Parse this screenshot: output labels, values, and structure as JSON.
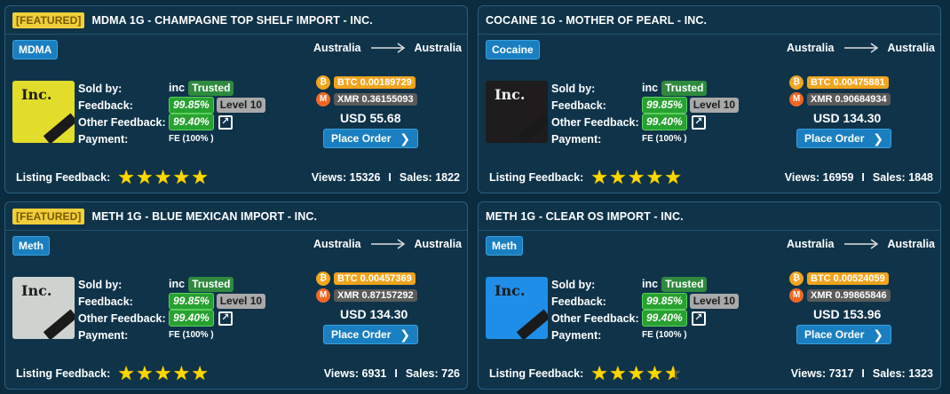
{
  "listings": [
    {
      "featured_label": "[FEATURED]",
      "featured": true,
      "title": "MDMA 1G - CHAMPAGNE TOP SHELF IMPORT - INC.",
      "category": "MDMA",
      "origin": "Australia",
      "destination": "Australia",
      "labels": {
        "sold_by": "Sold by:",
        "feedback": "Feedback:",
        "other_feedback": "Other Feedback:",
        "payment": "Payment:"
      },
      "seller": "inc",
      "trusted": "Trusted",
      "feedback_pct": "99.85%",
      "level": "Level 10",
      "other_feedback_pct": "99.40%",
      "payment": "FE (100% )",
      "btc": "BTC 0.00189729",
      "xmr": "XMR 0.36155093",
      "usd": "USD 55.68",
      "order_label": "Place Order",
      "listing_feedback_label": "Listing Feedback:",
      "rating": 5,
      "views": "Views: 15326",
      "sales": "Sales: 1822",
      "thumb_bg": "#e2dd2b"
    },
    {
      "featured_label": "",
      "featured": false,
      "title": "COCAINE 1G - MOTHER OF PEARL - INC.",
      "category": "Cocaine",
      "origin": "Australia",
      "destination": "Australia",
      "labels": {
        "sold_by": "Sold by:",
        "feedback": "Feedback:",
        "other_feedback": "Other Feedback:",
        "payment": "Payment:"
      },
      "seller": "inc",
      "trusted": "Trusted",
      "feedback_pct": "99.85%",
      "level": "Level 10",
      "other_feedback_pct": "99.40%",
      "payment": "FE (100% )",
      "btc": "BTC 0.00475881",
      "xmr": "XMR 0.90684934",
      "usd": "USD 134.30",
      "order_label": "Place Order",
      "listing_feedback_label": "Listing Feedback:",
      "rating": 5,
      "views": "Views: 16959",
      "sales": "Sales: 1848",
      "thumb_bg": "#1e1c1c"
    },
    {
      "featured_label": "[FEATURED]",
      "featured": true,
      "title": "METH 1G - BLUE MEXICAN IMPORT - INC.",
      "category": "Meth",
      "origin": "Australia",
      "destination": "Australia",
      "labels": {
        "sold_by": "Sold by:",
        "feedback": "Feedback:",
        "other_feedback": "Other Feedback:",
        "payment": "Payment:"
      },
      "seller": "inc",
      "trusted": "Trusted",
      "feedback_pct": "99.85%",
      "level": "Level 10",
      "other_feedback_pct": "99.40%",
      "payment": "FE (100% )",
      "btc": "BTC 0.00457369",
      "xmr": "XMR 0.87157292",
      "usd": "USD 134.30",
      "order_label": "Place Order",
      "listing_feedback_label": "Listing Feedback:",
      "rating": 5,
      "views": "Views: 6931",
      "sales": "Sales: 726",
      "thumb_bg": "#cfd3cf"
    },
    {
      "featured_label": "",
      "featured": false,
      "title": "METH 1G - CLEAR OS IMPORT - INC.",
      "category": "Meth",
      "origin": "Australia",
      "destination": "Australia",
      "labels": {
        "sold_by": "Sold by:",
        "feedback": "Feedback:",
        "other_feedback": "Other Feedback:",
        "payment": "Payment:"
      },
      "seller": "inc",
      "trusted": "Trusted",
      "feedback_pct": "99.85%",
      "level": "Level 10",
      "other_feedback_pct": "99.40%",
      "payment": "FE (100% )",
      "btc": "BTC 0.00524059",
      "xmr": "XMR 0.99865846",
      "usd": "USD 153.96",
      "order_label": "Place Order",
      "listing_feedback_label": "Listing Feedback:",
      "rating": 4.6,
      "views": "Views: 7317",
      "sales": "Sales: 1323",
      "thumb_bg": "#1f8ee8"
    }
  ],
  "thumb_text": "Inc.",
  "coin_symbols": {
    "btc": "₿",
    "xmr": "M"
  },
  "colors": {
    "background": "#0b2b3f",
    "card": "#0f3349",
    "accent": "#1a7fc0",
    "featured": "#f0cf3a",
    "star": "#ffd700"
  }
}
